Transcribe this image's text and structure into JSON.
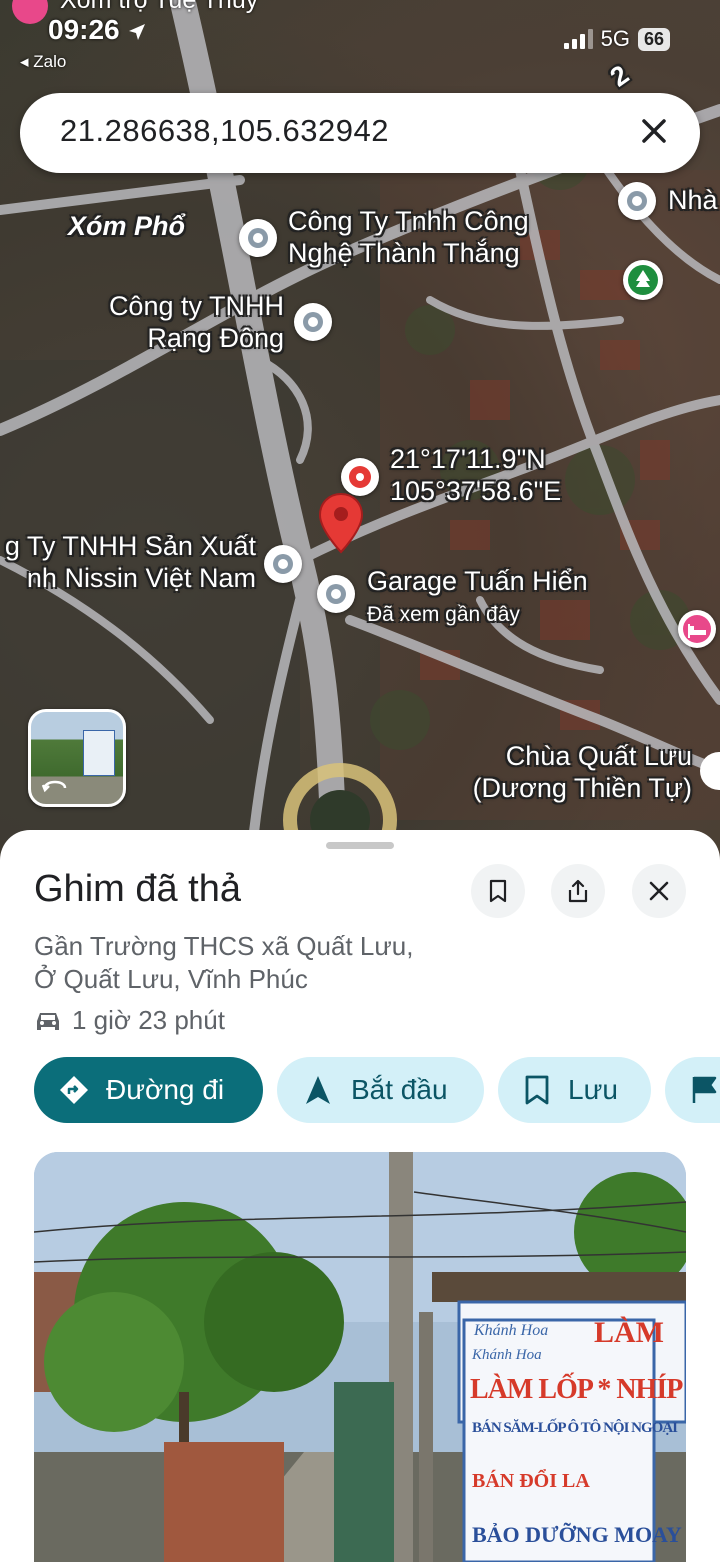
{
  "status_bar": {
    "time": "09:26",
    "top_notification": "Xóm trọ Tuệ Thủy",
    "back_app": "Zalo",
    "network": "5G",
    "battery": "66"
  },
  "search": {
    "query": "21.286638,105.632942"
  },
  "map": {
    "labels": {
      "xom_pho": "Xóm Phổ",
      "cong_ty_thanh_thang": [
        "Công Ty Tnhh Công",
        "Nghệ Thành Thắng"
      ],
      "nha": "Nhà",
      "rang_dong": [
        "Công ty TNHH",
        "Rạng Đông"
      ],
      "coordinates": [
        "21°17'11.9\"N",
        "105°37'58.6\"E"
      ],
      "nissin": [
        "g Ty TNHH Sản Xuất",
        "nh Nissin Việt Nam"
      ],
      "garage": "Garage Tuấn Hiển",
      "garage_sub": "Đã xem gần đây",
      "chua": [
        "Chùa Quất Lưu",
        "(Dương Thiền Tự)"
      ],
      "road_number": "2"
    },
    "icons": {
      "pin_color": "#e53935",
      "place_pin_color": "#8a9aa8",
      "park_color": "#1e8e3e",
      "hotel_color": "#e8488a"
    }
  },
  "sheet": {
    "title": "Ghim đã thả",
    "address_line1": "Gần Trường THCS xã Quất Lưu,",
    "address_line2": "Ở Quất Lưu, Vĩnh Phúc",
    "drive_time": "1 giờ 23 phút",
    "chips": {
      "directions": "Đường đi",
      "start": "Bắt đầu",
      "save": "Lưu"
    },
    "photo_sign": {
      "line0": "Khánh Hoa",
      "line0b": "LÀM",
      "line1": "Khánh Hoa",
      "line2": "LÀM LỐP * NHÍP",
      "line3": "BÁN SĂM-LỐP Ô TÔ NỘI NGOẠI",
      "line4": "BÁN ĐỔI LA",
      "line5": "BẢO DƯỠNG MOAY"
    }
  },
  "colors": {
    "primary": "#0b6e7a",
    "chip_bg": "#d3f0f8"
  }
}
